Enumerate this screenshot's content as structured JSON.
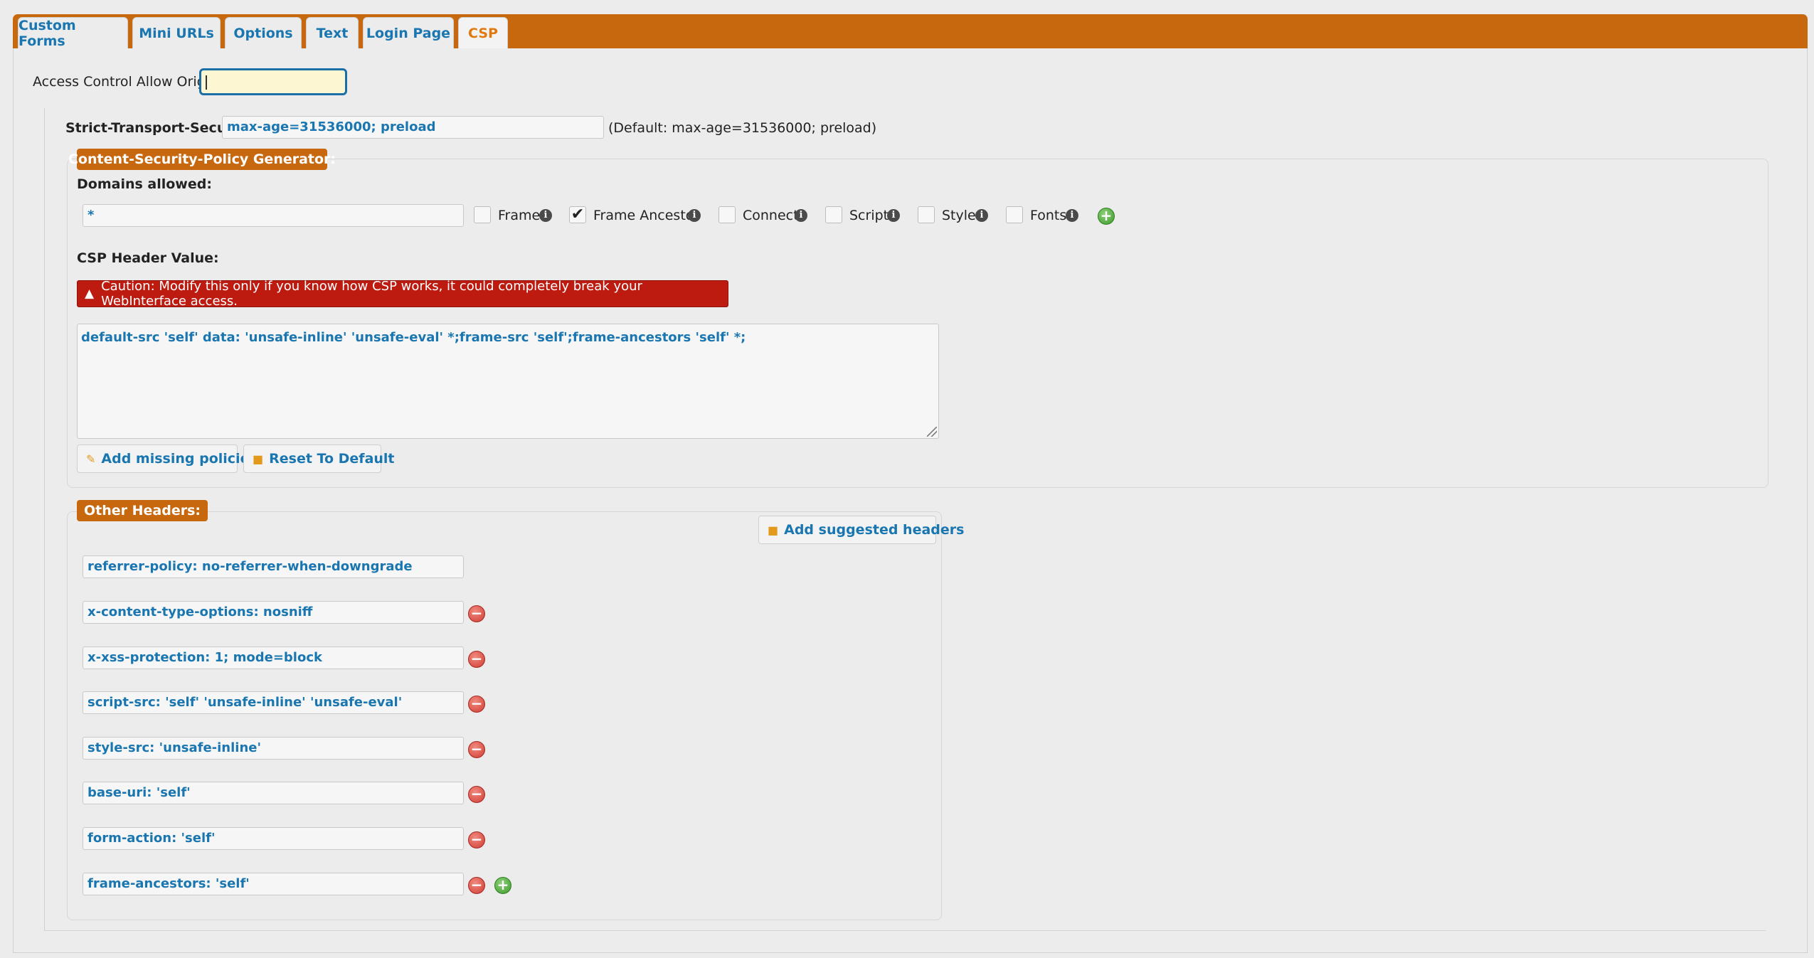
{
  "tabs": [
    "Custom Forms",
    "Mini URLs",
    "Options",
    "Text",
    "Login Page",
    "CSP"
  ],
  "active_tab": "CSP",
  "access_control": {
    "label": "Access Control Allow Origin:",
    "value": ""
  },
  "sts": {
    "label": "Strict-Transport-Security:",
    "value": "max-age=31536000; preload",
    "default_note": "(Default: max-age=31536000; preload)"
  },
  "csp_generator": {
    "legend": "Content-Security-Policy Generator:",
    "domains_label": "Domains allowed:",
    "domain_value": "*",
    "options": [
      {
        "label": "Frame",
        "checked": false
      },
      {
        "label": "Frame Ancestor",
        "checked": true
      },
      {
        "label": "Connect",
        "checked": false
      },
      {
        "label": "Script",
        "checked": false
      },
      {
        "label": "Style",
        "checked": false
      },
      {
        "label": "Fonts",
        "checked": false
      }
    ],
    "header_value_label": "CSP Header Value:",
    "caution": "Caution: Modify this only if you know how CSP works, it could completely break your WebInterface access.",
    "header_value": "default-src 'self' data: 'unsafe-inline' 'unsafe-eval' *;frame-src 'self';frame-ancestors 'self' *;",
    "add_missing_label": "Add missing policies",
    "reset_label": "Reset To Default"
  },
  "other_headers": {
    "legend": "Other Headers:",
    "add_suggested_label": "Add suggested headers",
    "items": [
      "referrer-policy: no-referrer-when-downgrade",
      "x-content-type-options: nosniff",
      "x-xss-protection: 1; mode=block",
      "script-src: 'self' 'unsafe-inline' 'unsafe-eval'",
      "style-src: 'unsafe-inline'",
      "base-uri: 'self'",
      "form-action: 'self'",
      "frame-ancestors: 'self'"
    ]
  },
  "colors": {
    "accent": "#c8680e",
    "link": "#1976b0",
    "danger": "#bd1a10"
  }
}
